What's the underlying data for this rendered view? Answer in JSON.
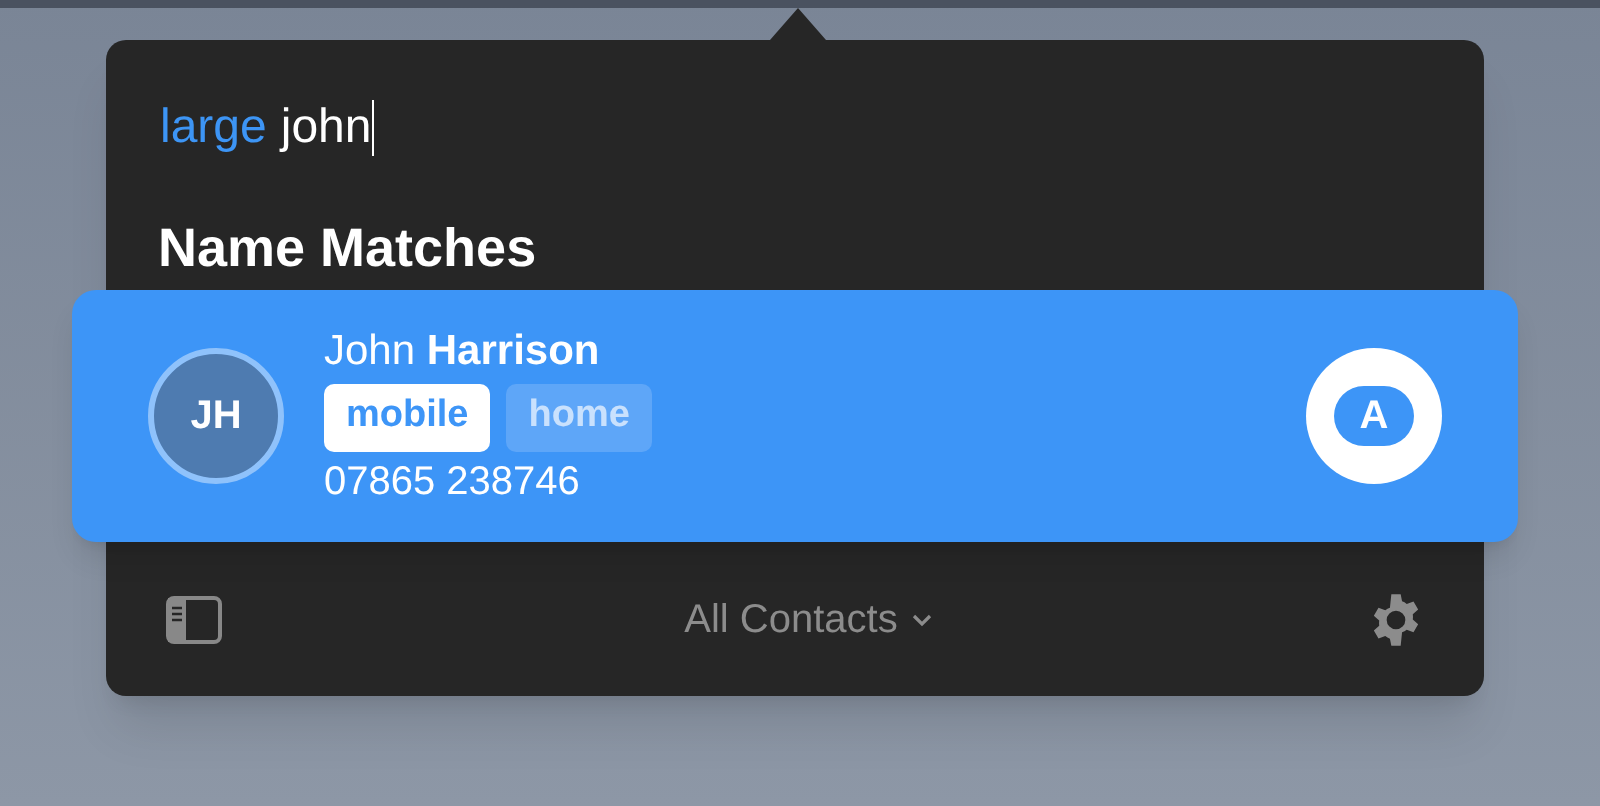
{
  "search": {
    "scope": "large",
    "query": "john"
  },
  "section_title": "Name Matches",
  "results": [
    {
      "initials": "JH",
      "name": "John **Harrison**",
      "selected": true,
      "labels": [
        {
          "text": "mobile",
          "selected": true
        },
        {
          "text": "home",
          "selected": false
        }
      ],
      "phone": "07865 238746",
      "badge": "A"
    }
  ],
  "footer": {
    "scope": "All Contacts"
  }
}
